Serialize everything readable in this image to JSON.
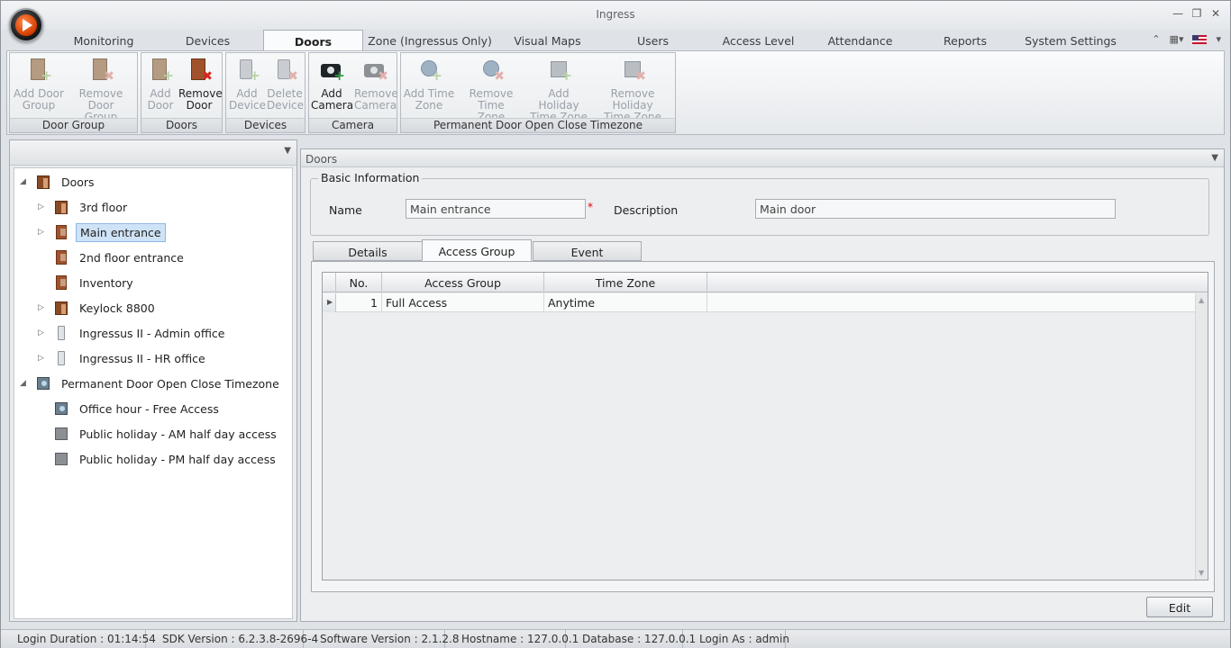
{
  "window": {
    "title": "Ingress"
  },
  "tabs": [
    {
      "label": "Monitoring",
      "active": false
    },
    {
      "label": "Devices",
      "active": false
    },
    {
      "label": "Doors",
      "active": true
    },
    {
      "label": "Zone (Ingressus Only)",
      "active": false
    },
    {
      "label": "Visual Maps",
      "active": false
    },
    {
      "label": "Users",
      "active": false
    },
    {
      "label": "Access Level",
      "active": false
    },
    {
      "label": "Attendance",
      "active": false
    },
    {
      "label": "Reports",
      "active": false
    },
    {
      "label": "System Settings",
      "active": false
    }
  ],
  "ribbon": {
    "groups": [
      {
        "label": "Door Group",
        "buttons": [
          {
            "line1": "Add Door",
            "line2": "Group",
            "icon": "door-add-icon",
            "enabled": false
          },
          {
            "line1": "Remove Door",
            "line2": "Group",
            "icon": "door-remove-icon",
            "enabled": false
          }
        ]
      },
      {
        "label": "Doors",
        "buttons": [
          {
            "line1": "Add",
            "line2": "Door",
            "icon": "door-add-icon",
            "enabled": false
          },
          {
            "line1": "Remove",
            "line2": "Door",
            "icon": "door-remove-icon",
            "enabled": true
          }
        ]
      },
      {
        "label": "Devices",
        "buttons": [
          {
            "line1": "Add",
            "line2": "Device",
            "icon": "device-add-icon",
            "enabled": false
          },
          {
            "line1": "Delete",
            "line2": "Device",
            "icon": "device-delete-icon",
            "enabled": false
          }
        ]
      },
      {
        "label": "Camera",
        "buttons": [
          {
            "line1": "Add",
            "line2": "Camera",
            "icon": "camera-add-icon",
            "enabled": true
          },
          {
            "line1": "Remove",
            "line2": "Camera",
            "icon": "camera-remove-icon",
            "enabled": false
          }
        ]
      },
      {
        "label": "Permanent Door Open Close Timezone",
        "buttons": [
          {
            "line1": "Add Time",
            "line2": "Zone",
            "icon": "timezone-add-icon",
            "enabled": false
          },
          {
            "line1": "Remove Time",
            "line2": "Zone",
            "icon": "timezone-remove-icon",
            "enabled": false
          },
          {
            "line1": "Add Holiday",
            "line2": "Time Zone",
            "icon": "holiday-add-icon",
            "enabled": false
          },
          {
            "line1": "Remove Holiday",
            "line2": "Time Zone",
            "icon": "holiday-remove-icon",
            "enabled": false
          }
        ]
      }
    ]
  },
  "tree": {
    "nodes": [
      {
        "label": "Doors",
        "level": 0,
        "arrow": "expanded",
        "icon": "doors-folder-icon",
        "selected": false
      },
      {
        "label": "3rd floor",
        "level": 1,
        "arrow": "collapsed",
        "icon": "door-group-icon",
        "selected": false
      },
      {
        "label": "Main entrance",
        "level": 1,
        "arrow": "collapsed",
        "icon": "door-icon",
        "selected": true
      },
      {
        "label": "2nd floor entrance",
        "level": 1,
        "arrow": "none",
        "icon": "door-icon",
        "selected": false
      },
      {
        "label": "Inventory",
        "level": 1,
        "arrow": "none",
        "icon": "door-icon",
        "selected": false
      },
      {
        "label": "Keylock 8800",
        "level": 1,
        "arrow": "collapsed",
        "icon": "door-group-icon",
        "selected": false
      },
      {
        "label": "Ingressus II - Admin office",
        "level": 1,
        "arrow": "collapsed",
        "icon": "device-icon",
        "selected": false
      },
      {
        "label": "Ingressus II - HR office",
        "level": 1,
        "arrow": "collapsed",
        "icon": "device-icon",
        "selected": false
      },
      {
        "label": "Permanent Door Open Close Timezone",
        "level": 0,
        "arrow": "expanded",
        "icon": "timezone-folder-icon",
        "selected": false
      },
      {
        "label": "Office hour - Free Access",
        "level": 1,
        "arrow": "none",
        "icon": "timezone-icon",
        "selected": false
      },
      {
        "label": "Public holiday - AM half day access",
        "level": 1,
        "arrow": "none",
        "icon": "holiday-timezone-icon",
        "selected": false
      },
      {
        "label": "Public holiday - PM half day access",
        "level": 1,
        "arrow": "none",
        "icon": "holiday-timezone-icon",
        "selected": false
      }
    ]
  },
  "detail": {
    "panel_title": "Doors",
    "basic_info_title": "Basic Information",
    "name_label": "Name",
    "name_value": "Main entrance",
    "required_mark": "*",
    "description_label": "Description",
    "description_value": "Main door",
    "subtabs": [
      {
        "label": "Details",
        "active": false
      },
      {
        "label": "Access Group",
        "active": true
      },
      {
        "label": "Event",
        "active": false
      }
    ],
    "grid": {
      "columns": [
        "No.",
        "Access Group",
        "Time Zone"
      ],
      "rows": [
        {
          "no": "1",
          "access_group": "Full Access",
          "time_zone": "Anytime"
        }
      ]
    },
    "edit_label": "Edit"
  },
  "status": {
    "items": [
      "Login Duration : 01:14:54",
      "SDK Version : 6.2.3.8-2696-4",
      "Software Version : 2.1.2.8",
      "Hostname : 127.0.0.1",
      "Database : 127.0.0.1",
      "Login As : admin"
    ]
  },
  "colors": {
    "accent_orange": "#d43b00",
    "selection": "#cfe3f7",
    "door_brown": "#a0522d"
  }
}
